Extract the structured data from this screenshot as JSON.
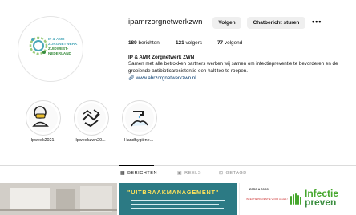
{
  "profile": {
    "username": "ipamrzorgnetwerkzwn",
    "logo_lines": [
      "IP & AMR",
      "ZORGNETWERK",
      "ZUIDWEST-NEDERLAND"
    ],
    "buttons": {
      "follow": "Volgen",
      "message": "Chatbericht sturen",
      "more": "•••"
    },
    "stats": {
      "posts": "189",
      "posts_label": "berichten",
      "followers": "121",
      "followers_label": "volgers",
      "following": "77",
      "following_label": "volgend"
    },
    "bio": {
      "name": "IP & AMR Zorgnetwerk ZWN",
      "text": "Samen met alle betrokken partners werken wij samen om infectiepreventie te bevorderen en de groeiende antibioticaresistentie een halt toe te roepen.",
      "link": "www.abrzorgnetwerkzwn.nl"
    }
  },
  "highlights": [
    {
      "label": "Ipweek2021",
      "icon": "person-mask-icon"
    },
    {
      "label": "Ipweekzwn20...",
      "icon": "handshake-icon"
    },
    {
      "label": "Handhygiëne...",
      "icon": "hand-washing-icon"
    }
  ],
  "tabs": [
    {
      "label": "BERICHTEN",
      "icon": "grid-icon",
      "active": true
    },
    {
      "label": "REELS",
      "icon": "reels-icon",
      "active": false
    },
    {
      "label": "GETAGD",
      "icon": "tag-icon",
      "active": false
    }
  ],
  "posts": {
    "post2_title": "\"UITBRAAKMANAGEMENT\"",
    "post3_small1": "ZORG & ZORG",
    "post3_small2": "INFECTIEPREVENTIE VOOR ALLES !",
    "post3_big1": "Infectie",
    "post3_big2": "preven"
  },
  "colors": {
    "brand_teal": "#49a7b8",
    "brand_green": "#3a8d3f",
    "accent_yellow": "#ffe35a",
    "link": "#00376b"
  }
}
